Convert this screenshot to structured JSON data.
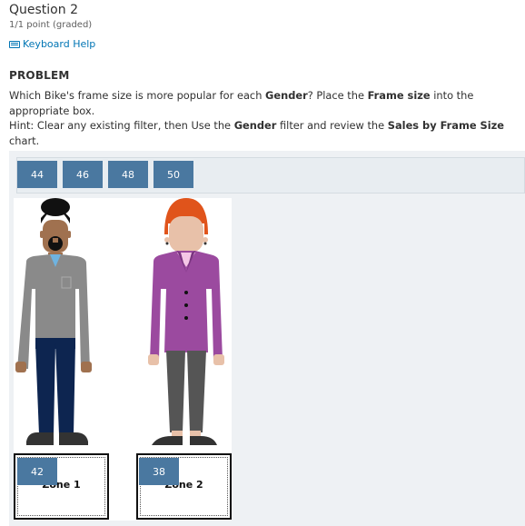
{
  "question": {
    "title": "Question 2",
    "points": "1/1 point (graded)",
    "keyboard_help": "Keyboard Help"
  },
  "problem": {
    "heading": "PROBLEM",
    "line1_a": "Which Bike's frame size is more popular for each ",
    "line1_b": "Gender",
    "line1_c": "? Place the ",
    "line1_d": "Frame size",
    "line1_e": " into the appropriate box.",
    "hint_a": "Hint: Clear any existing filter, then Use the ",
    "hint_b": "Gender",
    "hint_c": " filter and review the ",
    "hint_d": "Sales by Frame Size",
    "hint_e": " chart."
  },
  "bank": {
    "items": [
      "44",
      "46",
      "48",
      "50"
    ]
  },
  "zones": [
    {
      "label": "Zone 1",
      "placed": "42"
    },
    {
      "label": "Zone 2",
      "placed": "38"
    }
  ],
  "colors": {
    "accent": "#4a78a0",
    "link": "#0075b4"
  }
}
